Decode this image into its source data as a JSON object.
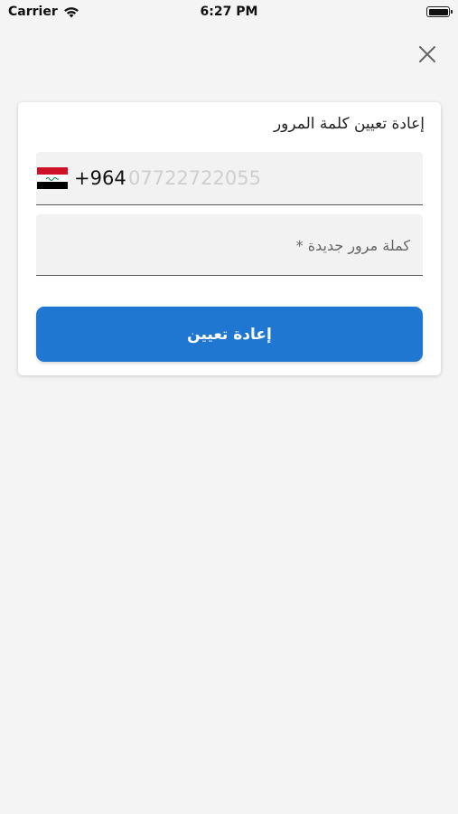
{
  "status_bar": {
    "carrier": "Carrier",
    "time": "6:27 PM",
    "wifi_icon": "wifi-icon",
    "battery_icon": "battery-icon"
  },
  "close_icon": "close-icon",
  "card": {
    "title": "إعادة تعيين كلمة المرور",
    "phone": {
      "flag_icon": "iraq-flag-icon",
      "flag_colors": [
        "#ce1126",
        "#ffffff",
        "#000000"
      ],
      "dial_code": "+964",
      "placeholder": "07722722055",
      "value": ""
    },
    "password": {
      "placeholder": "كملة مرور جديدة *",
      "value": ""
    },
    "reset_button_label": "إعادة تعيين"
  },
  "colors": {
    "accent": "#1f77d2",
    "background": "#f4f4f4",
    "field_background": "#f2f2f2"
  }
}
